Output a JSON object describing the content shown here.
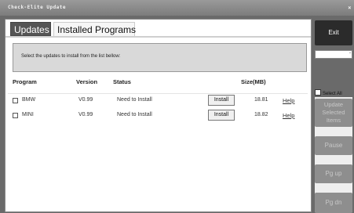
{
  "window": {
    "title": "Check-Elite Update",
    "close_glyph": "×"
  },
  "tabs": [
    {
      "label": "Updates",
      "active": true
    },
    {
      "label": "Installed Programs",
      "active": false
    }
  ],
  "instructions": "Select the updates to install from the list bellow:",
  "table": {
    "headers": [
      "Program",
      "Version",
      "Status",
      "Size(MB)"
    ],
    "rows": [
      {
        "program": "BMW",
        "version": "V0.99",
        "status": "Need to Install",
        "action": "Install",
        "size": "18.81",
        "help": "Help",
        "checked": false
      },
      {
        "program": "MINI",
        "version": "V0.99",
        "status": "Need to Install",
        "action": "Install",
        "size": "18.82",
        "help": "Help",
        "checked": false
      }
    ]
  },
  "sidebar": {
    "exit": "Exit",
    "field_glyph": "-",
    "select_all": "Select All",
    "update_selected": "Update Selected Items",
    "pause": "Pause",
    "pg_up": "Pg up",
    "pg_dn": "Pg dn"
  }
}
